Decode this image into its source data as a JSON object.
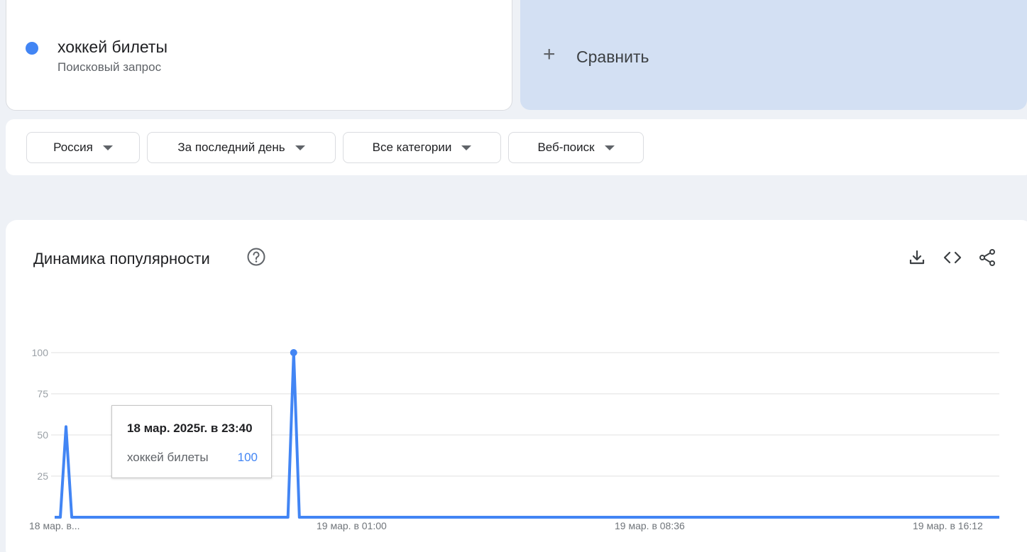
{
  "term": {
    "name": "хоккей билеты",
    "subtitle": "Поисковый запрос",
    "color": "#4285f4"
  },
  "compare": {
    "label": "Сравнить"
  },
  "filters": {
    "region": "Россия",
    "period": "За последний день",
    "category": "Все категории",
    "search_type": "Веб-поиск"
  },
  "chart_panel": {
    "title": "Динамика популярности",
    "icons": [
      "help-icon",
      "download-icon",
      "embed-icon",
      "share-icon"
    ]
  },
  "tooltip": {
    "date": "18 мар. 2025г. в 23:40",
    "term": "хоккей билеты",
    "value": "100"
  },
  "chart_data": {
    "type": "line",
    "title": "Динамика популярности",
    "xlabel": "",
    "ylabel": "",
    "ylim": [
      0,
      100
    ],
    "y_ticks": [
      "100",
      "75",
      "50",
      "25"
    ],
    "x_tick_labels": [
      "18 мар. в...",
      "19 мар. в 01:00",
      "19 мар. в 08:36",
      "19 мар. в 16:12"
    ],
    "grid": true,
    "series": [
      {
        "name": "хоккей билеты",
        "color": "#4285f4",
        "values": [
          0,
          0,
          55,
          0,
          0,
          0,
          0,
          0,
          0,
          0,
          0,
          0,
          0,
          0,
          0,
          0,
          0,
          0,
          0,
          0,
          0,
          0,
          0,
          0,
          0,
          0,
          0,
          0,
          0,
          0,
          0,
          0,
          0,
          0,
          0,
          0,
          0,
          0,
          0,
          0,
          0,
          0,
          100,
          0,
          0,
          0,
          0,
          0,
          0,
          0,
          0,
          0,
          0,
          0,
          0,
          0,
          0,
          0,
          0,
          0,
          0,
          0,
          0,
          0,
          0,
          0,
          0,
          0,
          0,
          0,
          0,
          0,
          0,
          0,
          0,
          0,
          0,
          0,
          0,
          0,
          0,
          0,
          0,
          0,
          0,
          0,
          0,
          0,
          0,
          0,
          0,
          0,
          0,
          0,
          0,
          0,
          0,
          0,
          0,
          0,
          0,
          0,
          0,
          0,
          0,
          0,
          0,
          0,
          0,
          0,
          0,
          0,
          0,
          0,
          0,
          0,
          0,
          0,
          0,
          0,
          0,
          0,
          0,
          0,
          0,
          0,
          0,
          0,
          0,
          0,
          0,
          0,
          0,
          0,
          0,
          0,
          0,
          0,
          0,
          0,
          0,
          0,
          0,
          0,
          0,
          0,
          0,
          0,
          0,
          0,
          0,
          0,
          0,
          0,
          0,
          0,
          0,
          0,
          0,
          0,
          0,
          0,
          0,
          0,
          0,
          0,
          0
        ]
      }
    ],
    "highlight_value": 100
  }
}
